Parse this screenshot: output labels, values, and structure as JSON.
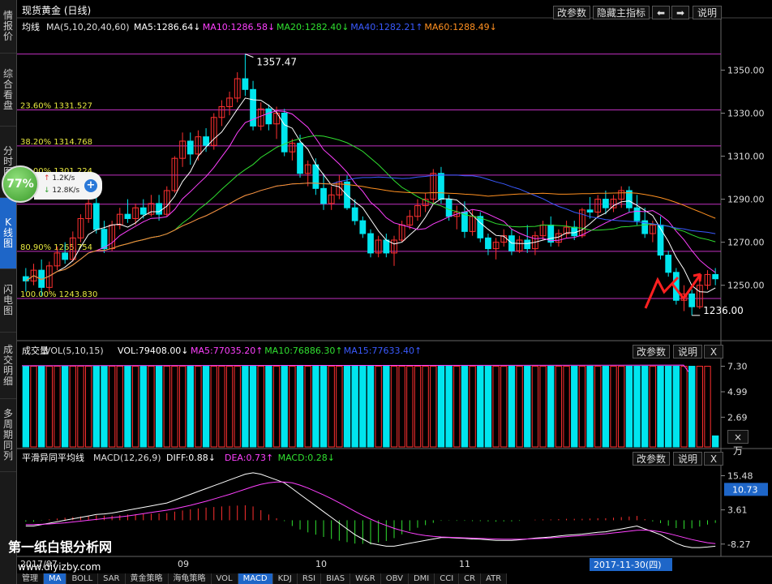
{
  "sidebar": {
    "tabs": [
      {
        "label": "情报价",
        "active": false
      },
      {
        "label": "综合看盘",
        "active": false
      },
      {
        "label": "分时图",
        "active": false
      },
      {
        "label": "K线图",
        "active": true
      },
      {
        "label": "闪电图",
        "active": false
      },
      {
        "label": "成交明细",
        "active": false
      },
      {
        "label": "多周期同列",
        "active": false
      }
    ]
  },
  "header": {
    "title": "现货黄金 (日线)",
    "buttons": {
      "params": "改参数",
      "hide_indicator": "隐藏主指标",
      "left": "⬅",
      "right": "➡",
      "explain": "说明"
    }
  },
  "ma_legend": {
    "label": "均线",
    "params": "MA(5,10,20,40,60)",
    "items": [
      {
        "text": "MA5:1286.64↓",
        "color": "#ffffff"
      },
      {
        "text": "MA10:1286.58↓",
        "color": "#ff40ff"
      },
      {
        "text": "MA20:1282.40↓",
        "color": "#30e030"
      },
      {
        "text": "MA40:1282.21↑",
        "color": "#3a5aff"
      },
      {
        "text": "MA60:1288.49↓",
        "color": "#ff9020"
      }
    ]
  },
  "fib_levels": [
    {
      "label": "",
      "value": 1357.47
    },
    {
      "label": "23.60% 1331.527",
      "value": 1331.527
    },
    {
      "label": "38.20% 1314.768",
      "value": 1314.768
    },
    {
      "label": "50.00% 1301.224",
      "value": 1301.224
    },
    {
      "label": "",
      "value": 1287.68
    },
    {
      "label": "80.90% 1265.754",
      "value": 1265.754
    },
    {
      "label": "100.00% 1243.830",
      "value": 1243.83
    }
  ],
  "annotations": {
    "high": "1357.47",
    "low": "1236.00"
  },
  "volume": {
    "label": "成交量",
    "params": "VOL(5,10,15)",
    "value": "VOL:79408.00↓",
    "items": [
      {
        "text": "MA5:77035.20↑",
        "color": "#ff40ff"
      },
      {
        "text": "MA10:76886.30↑",
        "color": "#30e030"
      },
      {
        "text": "MA15:77633.40↑",
        "color": "#3a5aff"
      }
    ],
    "buttons": {
      "params": "改参数",
      "explain": "说明",
      "close": "X"
    },
    "unit": "×万"
  },
  "macd": {
    "label": "平滑异同平均线",
    "params": "MACD(12,26,9)",
    "items": [
      {
        "text": "DIFF:0.88↓",
        "color": "#ffffff"
      },
      {
        "text": "DEA:0.73↑",
        "color": "#ff40ff"
      },
      {
        "text": "MACD:0.28↓",
        "color": "#30e030"
      }
    ],
    "buttons": {
      "params": "改参数",
      "explain": "说明",
      "close": "X"
    },
    "current_badge": "10.73"
  },
  "speed": {
    "percent": "77%",
    "up": "1.2K/s",
    "down": "12.8K/s"
  },
  "watermark": {
    "text": "第一纸白银分析网",
    "url": "www.diyizby.com"
  },
  "x_axis": {
    "labels": [
      "2017/07",
      "09",
      "10",
      "11"
    ],
    "date_badge": "2017-11-30(四)"
  },
  "bottom_tabs": [
    "管理",
    "MA",
    "BOLL",
    "SAR",
    "黄金策略",
    "海龟策略",
    "VOL",
    "MACD",
    "KDJ",
    "RSI",
    "BIAS",
    "W&R",
    "OBV",
    "DMI",
    "CCI",
    "CR",
    "ATR"
  ],
  "bottom_tabs_active": [
    1,
    7
  ],
  "colors": {
    "up": "#ff3030",
    "down": "#00e5ee",
    "fib": "#c030c0",
    "bg": "#000000"
  },
  "chart_data": [
    {
      "type": "candlestick",
      "title": "现货黄金 (日线)",
      "ylim": [
        1225,
        1366
      ],
      "y_ticks": [
        1350.0,
        1330.0,
        1310.0,
        1290.0,
        1270.0,
        1250.0
      ],
      "x_labels": [
        "2017/07",
        "09",
        "10",
        "11"
      ],
      "ohlc": [
        {
          "o": 1254,
          "h": 1258,
          "l": 1247,
          "c": 1252
        },
        {
          "o": 1252,
          "h": 1260,
          "l": 1250,
          "c": 1257
        },
        {
          "o": 1257,
          "h": 1262,
          "l": 1245,
          "c": 1249
        },
        {
          "o": 1249,
          "h": 1261,
          "l": 1247,
          "c": 1259
        },
        {
          "o": 1259,
          "h": 1268,
          "l": 1257,
          "c": 1265
        },
        {
          "o": 1265,
          "h": 1270,
          "l": 1260,
          "c": 1262
        },
        {
          "o": 1262,
          "h": 1275,
          "l": 1261,
          "c": 1272
        },
        {
          "o": 1272,
          "h": 1283,
          "l": 1270,
          "c": 1281
        },
        {
          "o": 1281,
          "h": 1290,
          "l": 1279,
          "c": 1288
        },
        {
          "o": 1288,
          "h": 1291,
          "l": 1274,
          "c": 1276
        },
        {
          "o": 1276,
          "h": 1280,
          "l": 1265,
          "c": 1267
        },
        {
          "o": 1267,
          "h": 1280,
          "l": 1266,
          "c": 1278
        },
        {
          "o": 1278,
          "h": 1286,
          "l": 1276,
          "c": 1283
        },
        {
          "o": 1283,
          "h": 1290,
          "l": 1279,
          "c": 1281
        },
        {
          "o": 1281,
          "h": 1288,
          "l": 1278,
          "c": 1286
        },
        {
          "o": 1286,
          "h": 1290,
          "l": 1281,
          "c": 1283
        },
        {
          "o": 1283,
          "h": 1292,
          "l": 1282,
          "c": 1288
        },
        {
          "o": 1288,
          "h": 1292,
          "l": 1280,
          "c": 1283
        },
        {
          "o": 1283,
          "h": 1296,
          "l": 1282,
          "c": 1294
        },
        {
          "o": 1294,
          "h": 1310,
          "l": 1293,
          "c": 1309
        },
        {
          "o": 1309,
          "h": 1321,
          "l": 1305,
          "c": 1317
        },
        {
          "o": 1317,
          "h": 1321,
          "l": 1306,
          "c": 1311
        },
        {
          "o": 1311,
          "h": 1322,
          "l": 1308,
          "c": 1319
        },
        {
          "o": 1319,
          "h": 1323,
          "l": 1312,
          "c": 1315
        },
        {
          "o": 1315,
          "h": 1330,
          "l": 1313,
          "c": 1328
        },
        {
          "o": 1328,
          "h": 1336,
          "l": 1324,
          "c": 1333
        },
        {
          "o": 1333,
          "h": 1340,
          "l": 1329,
          "c": 1337
        },
        {
          "o": 1337,
          "h": 1349,
          "l": 1335,
          "c": 1346
        },
        {
          "o": 1346,
          "h": 1357.47,
          "l": 1338,
          "c": 1341
        },
        {
          "o": 1341,
          "h": 1345,
          "l": 1322,
          "c": 1324
        },
        {
          "o": 1324,
          "h": 1335,
          "l": 1322,
          "c": 1332
        },
        {
          "o": 1332,
          "h": 1334,
          "l": 1322,
          "c": 1325
        },
        {
          "o": 1325,
          "h": 1333,
          "l": 1318,
          "c": 1330
        },
        {
          "o": 1330,
          "h": 1332,
          "l": 1310,
          "c": 1312
        },
        {
          "o": 1312,
          "h": 1318,
          "l": 1308,
          "c": 1316
        },
        {
          "o": 1316,
          "h": 1320,
          "l": 1300,
          "c": 1302
        },
        {
          "o": 1302,
          "h": 1308,
          "l": 1296,
          "c": 1306
        },
        {
          "o": 1306,
          "h": 1309,
          "l": 1292,
          "c": 1295
        },
        {
          "o": 1295,
          "h": 1302,
          "l": 1285,
          "c": 1288
        },
        {
          "o": 1288,
          "h": 1296,
          "l": 1285,
          "c": 1292
        },
        {
          "o": 1292,
          "h": 1301,
          "l": 1290,
          "c": 1298
        },
        {
          "o": 1298,
          "h": 1301,
          "l": 1285,
          "c": 1286
        },
        {
          "o": 1286,
          "h": 1290,
          "l": 1278,
          "c": 1280
        },
        {
          "o": 1280,
          "h": 1282,
          "l": 1272,
          "c": 1274
        },
        {
          "o": 1274,
          "h": 1276,
          "l": 1263,
          "c": 1265
        },
        {
          "o": 1265,
          "h": 1273,
          "l": 1263,
          "c": 1271
        },
        {
          "o": 1271,
          "h": 1274,
          "l": 1263,
          "c": 1265
        },
        {
          "o": 1265,
          "h": 1273,
          "l": 1259,
          "c": 1271
        },
        {
          "o": 1271,
          "h": 1280,
          "l": 1270,
          "c": 1278
        },
        {
          "o": 1278,
          "h": 1285,
          "l": 1276,
          "c": 1282
        },
        {
          "o": 1282,
          "h": 1290,
          "l": 1280,
          "c": 1287
        },
        {
          "o": 1287,
          "h": 1293,
          "l": 1284,
          "c": 1290
        },
        {
          "o": 1290,
          "h": 1304,
          "l": 1288,
          "c": 1302
        },
        {
          "o": 1302,
          "h": 1305,
          "l": 1288,
          "c": 1290
        },
        {
          "o": 1290,
          "h": 1292,
          "l": 1280,
          "c": 1282
        },
        {
          "o": 1282,
          "h": 1287,
          "l": 1276,
          "c": 1284
        },
        {
          "o": 1284,
          "h": 1289,
          "l": 1272,
          "c": 1275
        },
        {
          "o": 1275,
          "h": 1285,
          "l": 1273,
          "c": 1282
        },
        {
          "o": 1282,
          "h": 1284,
          "l": 1270,
          "c": 1272
        },
        {
          "o": 1272,
          "h": 1274,
          "l": 1264,
          "c": 1267
        },
        {
          "o": 1267,
          "h": 1272,
          "l": 1262,
          "c": 1270
        },
        {
          "o": 1270,
          "h": 1276,
          "l": 1268,
          "c": 1273
        },
        {
          "o": 1273,
          "h": 1276,
          "l": 1264,
          "c": 1266
        },
        {
          "o": 1266,
          "h": 1273,
          "l": 1265,
          "c": 1271
        },
        {
          "o": 1271,
          "h": 1278,
          "l": 1265,
          "c": 1267
        },
        {
          "o": 1267,
          "h": 1275,
          "l": 1264,
          "c": 1273
        },
        {
          "o": 1273,
          "h": 1280,
          "l": 1271,
          "c": 1278
        },
        {
          "o": 1278,
          "h": 1282,
          "l": 1268,
          "c": 1270
        },
        {
          "o": 1270,
          "h": 1276,
          "l": 1268,
          "c": 1274
        },
        {
          "o": 1274,
          "h": 1280,
          "l": 1272,
          "c": 1277
        },
        {
          "o": 1277,
          "h": 1280,
          "l": 1271,
          "c": 1273
        },
        {
          "o": 1273,
          "h": 1286,
          "l": 1272,
          "c": 1285
        },
        {
          "o": 1285,
          "h": 1291,
          "l": 1281,
          "c": 1284
        },
        {
          "o": 1284,
          "h": 1292,
          "l": 1282,
          "c": 1290
        },
        {
          "o": 1290,
          "h": 1294,
          "l": 1283,
          "c": 1286
        },
        {
          "o": 1286,
          "h": 1292,
          "l": 1284,
          "c": 1290
        },
        {
          "o": 1290,
          "h": 1296,
          "l": 1286,
          "c": 1294
        },
        {
          "o": 1294,
          "h": 1296,
          "l": 1284,
          "c": 1286
        },
        {
          "o": 1286,
          "h": 1292,
          "l": 1278,
          "c": 1280
        },
        {
          "o": 1280,
          "h": 1286,
          "l": 1272,
          "c": 1274
        },
        {
          "o": 1274,
          "h": 1280,
          "l": 1270,
          "c": 1278
        },
        {
          "o": 1278,
          "h": 1282,
          "l": 1262,
          "c": 1264
        },
        {
          "o": 1264,
          "h": 1266,
          "l": 1254,
          "c": 1256
        },
        {
          "o": 1256,
          "h": 1258,
          "l": 1241,
          "c": 1243
        },
        {
          "o": 1243,
          "h": 1250,
          "l": 1238,
          "c": 1246
        },
        {
          "o": 1246,
          "h": 1248,
          "l": 1236,
          "c": 1240
        },
        {
          "o": 1240,
          "h": 1252,
          "l": 1239,
          "c": 1250
        },
        {
          "o": 1250,
          "h": 1257,
          "l": 1248,
          "c": 1255
        },
        {
          "o": 1255,
          "h": 1258,
          "l": 1250,
          "c": 1253
        }
      ]
    },
    {
      "type": "bar",
      "title": "成交量",
      "ylim": [
        0,
        8.0
      ],
      "y_ticks": [
        7.3,
        4.99,
        2.69
      ],
      "values": [
        7.3,
        7.3,
        7.3,
        7.3,
        7.3,
        7.3,
        7.3,
        7.3,
        7.3,
        7.3,
        7.3,
        7.3,
        7.3,
        7.3,
        7.3,
        7.3,
        7.3,
        7.3,
        7.3,
        7.3,
        7.3,
        7.3,
        7.3,
        7.3,
        7.3,
        7.3,
        7.3,
        7.3,
        7.3,
        7.3,
        7.3,
        7.3,
        7.3,
        7.3,
        7.3,
        7.3,
        7.3,
        7.3,
        7.3,
        7.3,
        7.3,
        7.3,
        7.3,
        7.3,
        7.3,
        7.3,
        7.3,
        7.3,
        7.3,
        7.3,
        7.3,
        7.3,
        7.3,
        7.3,
        7.3,
        7.3,
        7.3,
        7.3,
        7.3,
        7.3,
        7.3,
        7.3,
        7.3,
        7.3,
        7.3,
        7.3,
        7.3,
        7.3,
        7.3,
        7.3,
        7.3,
        7.3,
        7.3,
        7.3,
        7.3,
        7.3,
        7.3,
        7.3,
        7.3,
        7.3,
        7.3,
        7.3,
        7.3,
        7.3,
        7.3,
        7.3,
        7.3,
        7.3,
        1.0
      ]
    },
    {
      "type": "line",
      "title": "平滑异同平均线",
      "ylim": [
        -12,
        19
      ],
      "y_ticks": [
        15.48,
        3.61,
        -8.27
      ],
      "series": [
        {
          "name": "DIFF",
          "color": "#ffffff",
          "values": [
            -2,
            -2,
            -1.5,
            -1,
            -0.5,
            0,
            0.5,
            1,
            1.5,
            2,
            2.2,
            2.5,
            3,
            3.5,
            4,
            4.5,
            5,
            5.5,
            6,
            7,
            8,
            9,
            10,
            11,
            12,
            13,
            14,
            15,
            16,
            16.5,
            16,
            15,
            14,
            13,
            11,
            9,
            7,
            5,
            3,
            1,
            -1,
            -3,
            -5,
            -6.5,
            -8,
            -8.5,
            -9,
            -9,
            -8.5,
            -8,
            -7.5,
            -7,
            -6.5,
            -6,
            -6,
            -6.2,
            -6.3,
            -6.5,
            -6.6,
            -6.8,
            -7,
            -7,
            -7,
            -6.8,
            -6.5,
            -6.2,
            -6,
            -5.8,
            -5.5,
            -5.2,
            -5,
            -4.8,
            -4.5,
            -4.2,
            -4,
            -3.5,
            -3,
            -2.5,
            -2,
            -3,
            -4,
            -5,
            -6.5,
            -8,
            -9,
            -9.5,
            -9.5,
            -9.3,
            -9
          ]
        },
        {
          "name": "DEA",
          "color": "#ff40ff",
          "values": [
            -1.5,
            -1.5,
            -1.4,
            -1.3,
            -1.1,
            -0.9,
            -0.6,
            -0.3,
            0,
            0.3,
            0.6,
            0.9,
            1.2,
            1.5,
            1.9,
            2.3,
            2.7,
            3.1,
            3.5,
            4,
            4.6,
            5.2,
            5.9,
            6.6,
            7.4,
            8.2,
            9,
            9.9,
            10.8,
            11.7,
            12.5,
            13,
            13.3,
            13.3,
            13,
            12.2,
            11.2,
            10,
            8.8,
            7.5,
            6.1,
            4.6,
            3.1,
            1.7,
            0.4,
            -0.8,
            -1.8,
            -2.8,
            -3.6,
            -4.3,
            -4.9,
            -5.3,
            -5.6,
            -5.8,
            -5.9,
            -6,
            -6.1,
            -6.2,
            -6.3,
            -6.4,
            -6.5,
            -6.6,
            -6.6,
            -6.6,
            -6.5,
            -6.4,
            -6.3,
            -6.1,
            -5.9,
            -5.7,
            -5.5,
            -5.3,
            -5.1,
            -4.9,
            -4.7,
            -4.4,
            -4.1,
            -3.8,
            -3.5,
            -3.4,
            -3.6,
            -4,
            -4.6,
            -5.3,
            -6,
            -6.7,
            -7.3,
            -7.8,
            -8.1
          ]
        }
      ],
      "histogram": [
        -0.5,
        -0.5,
        -0.1,
        0.3,
        0.6,
        0.9,
        1.1,
        1.3,
        1.5,
        1.7,
        1.6,
        1.6,
        1.8,
        2,
        2.1,
        2.2,
        2.3,
        2.4,
        2.5,
        3,
        3.4,
        3.8,
        4.1,
        4.4,
        4.6,
        4.8,
        5,
        5.1,
        5.2,
        4.8,
        3.5,
        2,
        0.7,
        -0.3,
        -2,
        -3.2,
        -4.2,
        -5,
        -5.8,
        -6.5,
        -7.1,
        -7.6,
        -8.1,
        -8.2,
        -8.4,
        -7.7,
        -7.2,
        -6.2,
        -4.9,
        -3.7,
        -2.6,
        -1.7,
        -0.9,
        -0.2,
        -0.1,
        -0.2,
        -0.2,
        -0.3,
        -0.3,
        -0.4,
        -0.5,
        -0.4,
        -0.4,
        -0.2,
        0,
        0.2,
        0.3,
        0.3,
        0.4,
        0.5,
        0.5,
        0.5,
        0.6,
        0.7,
        0.7,
        0.9,
        1.1,
        1.3,
        1.5,
        0.4,
        -0.4,
        -1,
        -1.9,
        -2.7,
        -3,
        -2.8,
        -2.2,
        -1.5,
        -0.9
      ]
    }
  ]
}
